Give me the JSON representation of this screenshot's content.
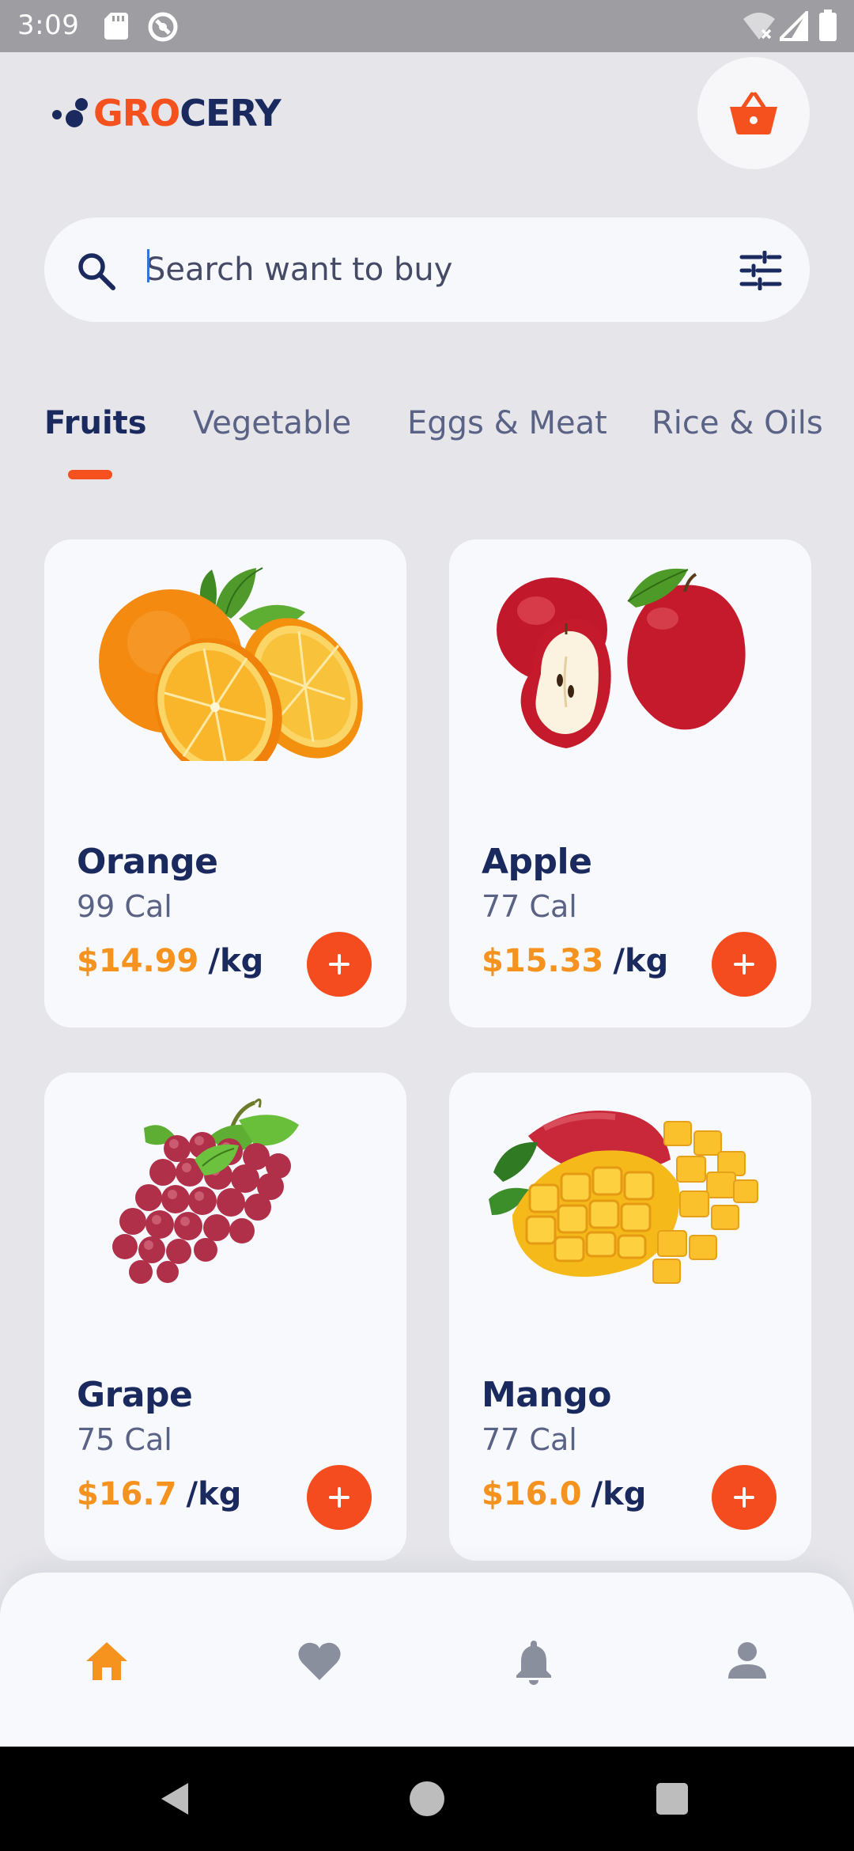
{
  "status_bar": {
    "time": "3:09",
    "icons": [
      "sd-card-icon",
      "sync-icon",
      "wifi-off-icon",
      "signal-icon",
      "battery-icon"
    ]
  },
  "header": {
    "logo_gro": "GRO",
    "logo_cery": "CERY",
    "cart_icon": "basket-icon"
  },
  "search": {
    "placeholder": "Search want to buy",
    "search_icon": "search-icon",
    "filter_icon": "filter-sliders-icon"
  },
  "tabs": [
    {
      "label": "Fruits",
      "active": true
    },
    {
      "label": "Vegetable",
      "active": false
    },
    {
      "label": "Eggs & Meat",
      "active": false
    },
    {
      "label": "Rice & Oils",
      "active": false
    }
  ],
  "products": [
    {
      "name": "Orange",
      "calories": "99 Cal",
      "price": "$14.99",
      "unit": "/kg",
      "image": "orange-image"
    },
    {
      "name": "Apple",
      "calories": "77 Cal",
      "price": "$15.33",
      "unit": "/kg",
      "image": "apple-image"
    },
    {
      "name": "Grape",
      "calories": "75 Cal",
      "price": "$16.7",
      "unit": "/kg",
      "image": "grape-image"
    },
    {
      "name": "Mango",
      "calories": "77 Cal",
      "price": "$16.0",
      "unit": "/kg",
      "image": "mango-image"
    }
  ],
  "bottom_nav": [
    {
      "icon": "home-icon",
      "active": true
    },
    {
      "icon": "heart-icon",
      "active": false
    },
    {
      "icon": "bell-icon",
      "active": false
    },
    {
      "icon": "person-icon",
      "active": false
    }
  ],
  "colors": {
    "accent": "#f4511e",
    "price": "#f6921e",
    "navy": "#1a2a5e",
    "nav_active": "#f6921e",
    "nav_inactive": "#8a8f9e"
  }
}
